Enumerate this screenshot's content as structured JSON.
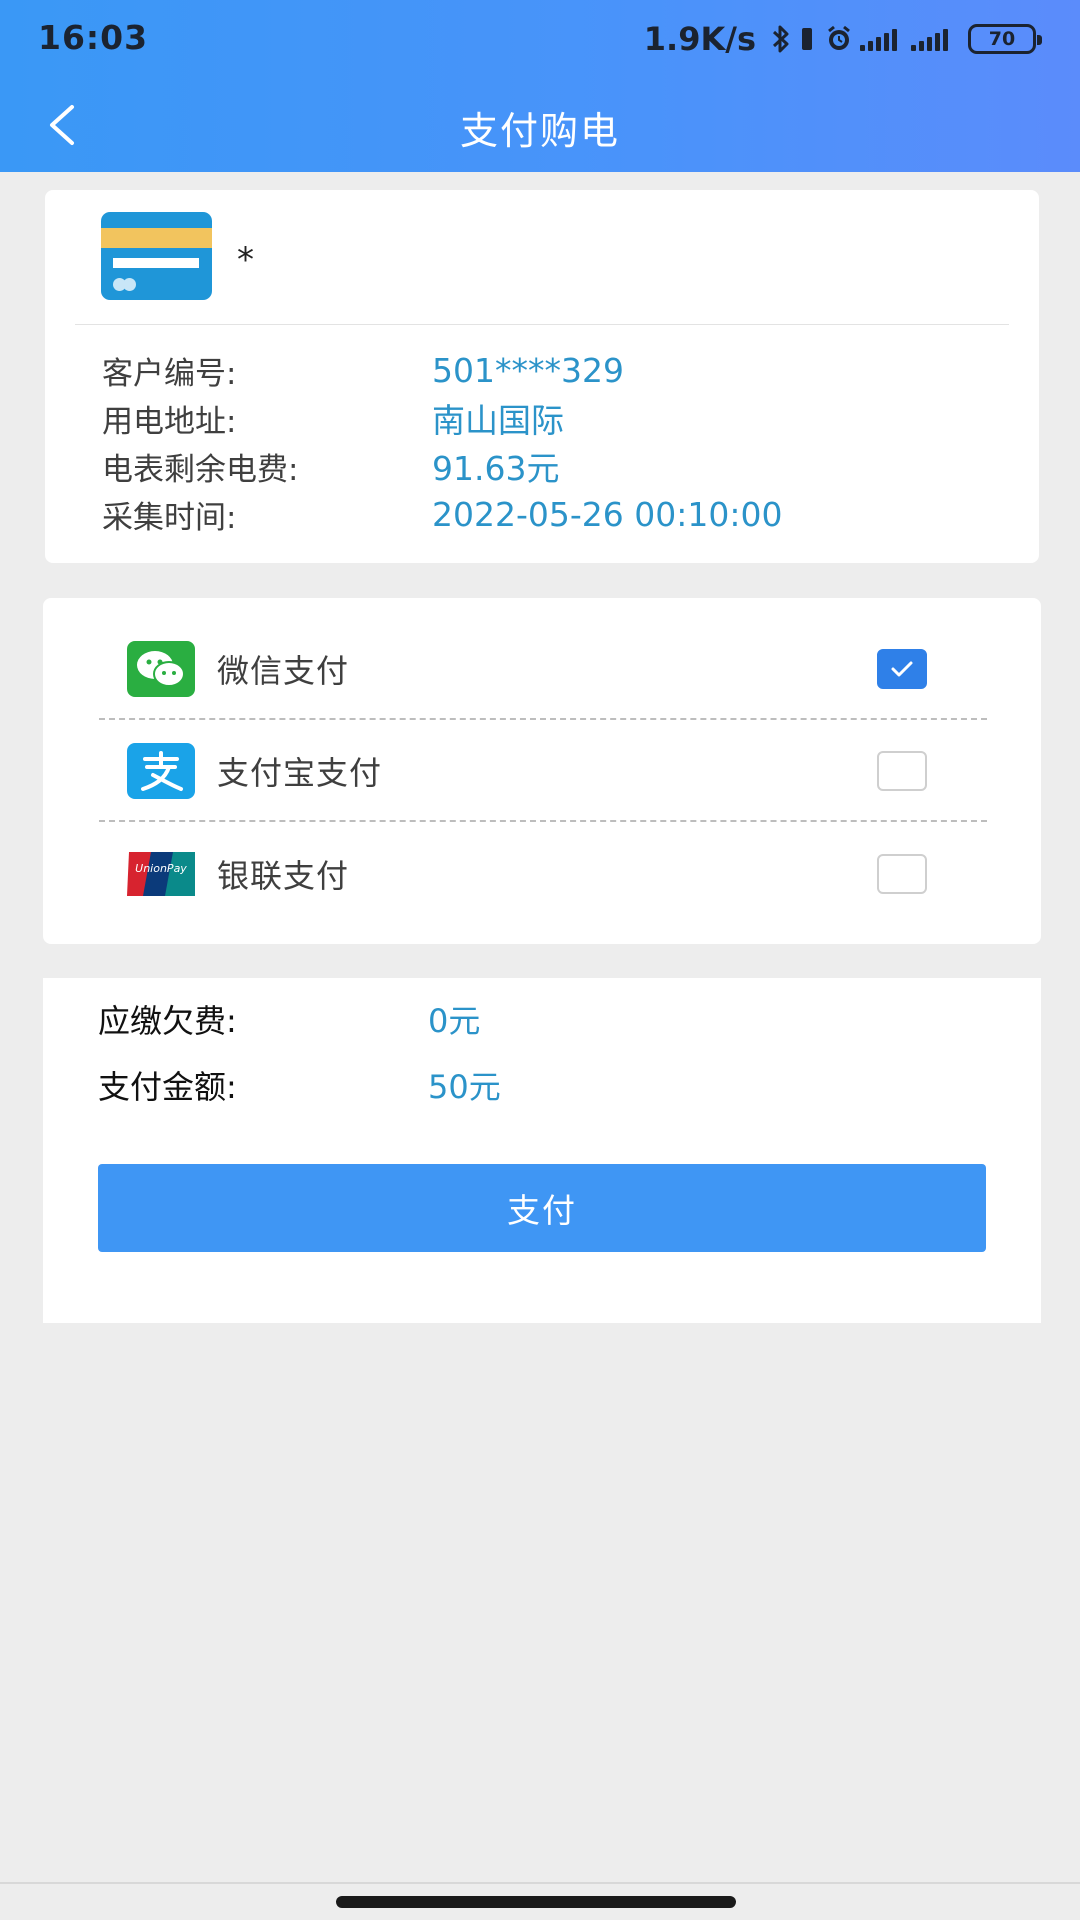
{
  "status_bar": {
    "time": "16:03",
    "net_speed": "1.9K/s",
    "battery": "70",
    "icons": [
      "bluetooth-icon",
      "vibrate-icon",
      "alarm-icon",
      "signal-5g-icon",
      "signal-4g-icon"
    ]
  },
  "header": {
    "title": "支付购电",
    "back_icon": "chevron-left-icon"
  },
  "account": {
    "name": "*",
    "rows": [
      {
        "label": "客户编号:",
        "value": "501****329"
      },
      {
        "label": "用电地址:",
        "value": "南山国际"
      },
      {
        "label": "电表剩余电费:",
        "value": "91.63元"
      },
      {
        "label": "采集时间:",
        "value": "2022-05-26 00:10:00"
      }
    ]
  },
  "payment_methods": [
    {
      "label": "微信支付",
      "icon": "wechat-pay-icon",
      "checked": true
    },
    {
      "label": "支付宝支付",
      "icon": "alipay-icon",
      "checked": false
    },
    {
      "label": "银联支付",
      "icon": "unionpay-icon",
      "checked": false
    }
  ],
  "summary": {
    "arrears_label": "应缴欠费:",
    "arrears_value": "0元",
    "amount_label": "支付金额:",
    "amount_value": "50元"
  },
  "pay_button": "支付",
  "colors": {
    "header": "#4a93fa",
    "accent_value": "#2b93c9",
    "button": "#3f96f4",
    "checkbox_checked": "#2f80e8"
  }
}
